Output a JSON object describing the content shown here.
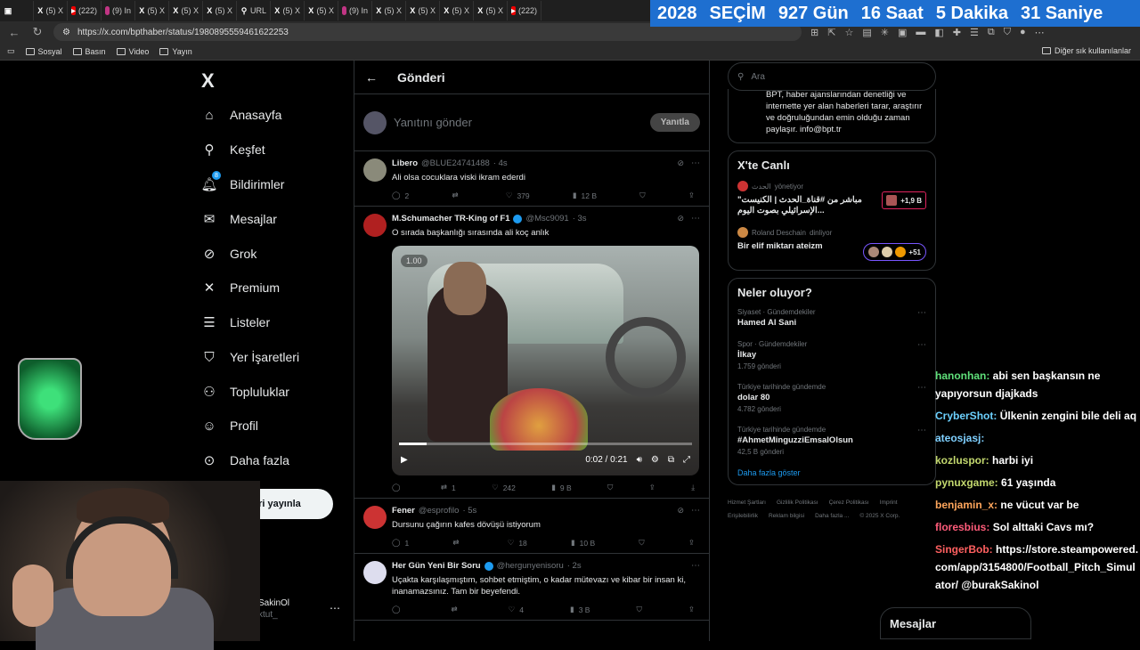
{
  "browser": {
    "tabs": [
      {
        "icon": "X",
        "label": "(5) X"
      },
      {
        "icon": "YT",
        "label": "(222)"
      },
      {
        "icon": "IG",
        "label": "(9) In"
      },
      {
        "icon": "X",
        "label": "(5) X"
      },
      {
        "icon": "X",
        "label": "(5) X"
      },
      {
        "icon": "X",
        "label": "(5) X"
      },
      {
        "icon": "URL",
        "label": "URL"
      },
      {
        "icon": "X",
        "label": "(5) X"
      },
      {
        "icon": "X",
        "label": "(5) X"
      },
      {
        "icon": "IG",
        "label": "(9) In"
      },
      {
        "icon": "X",
        "label": "(5) X"
      },
      {
        "icon": "X",
        "label": "(5) X"
      },
      {
        "icon": "X",
        "label": "(5) X"
      },
      {
        "icon": "X",
        "label": "(5) X"
      },
      {
        "icon": "YT",
        "label": "(222)"
      }
    ],
    "url": "https://x.com/bpthaber/status/1980895559461622253",
    "bookmarks": [
      "Sosyal",
      "Basın",
      "Video",
      "Yayın"
    ],
    "bookmarks_right": "Diğer sık kullanılanlar"
  },
  "countdown": {
    "year": "2028",
    "label": "SEÇİM",
    "days": "927 Gün",
    "hours": "16 Saat",
    "minutes": "5 Dakika",
    "seconds": "31 Saniye"
  },
  "nav": {
    "logo": "X",
    "items": [
      "Anasayfa",
      "Keşfet",
      "Bildirimler",
      "Mesajlar",
      "Grok",
      "Premium",
      "Listeler",
      "Yer İşaretleri",
      "Topluluklar",
      "Profil",
      "Daha fazla"
    ],
    "notif_count": "8",
    "post_button": "Gönderi yayınla",
    "account_name": "SakinOl",
    "account_handle": "ktut_"
  },
  "main": {
    "title": "Gönderi",
    "reply_placeholder": "Yanıtını gönder",
    "reply_button": "Yanıtla",
    "tweets": [
      {
        "name": "Libero",
        "handle": "@BLUE24741488",
        "time": "· 4s",
        "text": "Ali olsa cocuklara viski ikram ederdi",
        "replies": "2",
        "reposts": "",
        "likes": "379",
        "views": "12 B"
      },
      {
        "name": "M.Schumacher TR-King of F1",
        "handle": "@Msc9091",
        "time": "· 3s",
        "text": "O sırada başkanlığı sırasında ali koç anlık",
        "replies": "",
        "reposts": "1",
        "likes": "242",
        "views": "9 B",
        "video": {
          "speed": "1.00",
          "time": "0:02 / 0:21",
          "progress": 0.095
        }
      },
      {
        "name": "Fener",
        "handle": "@esprofilo",
        "time": "· 5s",
        "text": "Dursunu çağırın kafes dövüşü istiyorum",
        "replies": "1",
        "reposts": "",
        "likes": "18",
        "views": "10 B"
      },
      {
        "name": "Her Gün Yeni Bir Soru",
        "handle": "@hergunyenisoru",
        "time": "· 2s",
        "text": "Uçakta karşılaşmıştım, sohbet etmiştim, o kadar mütevazı ve kibar bir insan ki, inanamazsınız. Tam bir beyefendi.",
        "replies": "",
        "reposts": "",
        "likes": "4",
        "views": "3 B"
      }
    ]
  },
  "right": {
    "search_placeholder": "Ara",
    "about_text": "BPT, haber ajanslarından denetliği ve internette yer alan haberleri tarar, araştırır ve doğruluğundan emin olduğu zaman paylaşır. info@bpt.tr",
    "live_title": "X'te Canlı",
    "live": [
      {
        "host": "الحدث",
        "role": "yönetiyor",
        "title": "مباشر من #قناة_الحدث | الكنيست\" الإسرائيلي بصوت اليوم...",
        "badge": "+1,9 B"
      },
      {
        "host": "Roland Deschain",
        "role": "dinliyor",
        "title": "Bir elif miktarı ateizm",
        "badge": "+51"
      }
    ],
    "trends_title": "Neler oluyor?",
    "trends": [
      {
        "cat": "Siyaset · Gündemdekiler",
        "name": "Hamed Al Sani",
        "count": ""
      },
      {
        "cat": "Spor · Gündemdekiler",
        "name": "İlkay",
        "count": "1.759 gönderi"
      },
      {
        "cat": "Türkiye tarihinde gündemde",
        "name": "dolar 80",
        "count": "4.782 gönderi"
      },
      {
        "cat": "Türkiye tarihinde gündemde",
        "name": "#AhmetMinguzziEmsalOlsun",
        "count": "42,5 B gönderi"
      }
    ],
    "show_more": "Daha fazla göster",
    "footer": [
      "Hizmet Şartları",
      "Gizlilik Politikası",
      "Çerez Politikası",
      "Imprint",
      "Erişilebilirlik",
      "Reklam bilgisi",
      "Daha fazla ...",
      "© 2025 X Corp."
    ]
  },
  "chat": [
    {
      "user": "hanonhan:",
      "text": "abi sen başkansın ne yapıyorsun djajkads"
    },
    {
      "user": "CryberShot:",
      "text": "Ülkenin zengini bile deli aq"
    },
    {
      "user": "ateosjasj:",
      "text": ""
    },
    {
      "user": "kozluspor:",
      "text": "harbi iyi"
    },
    {
      "user": "pynuxgame:",
      "text": "61 yaşında"
    },
    {
      "user": "benjamin_x:",
      "text": "ne vücut var be"
    },
    {
      "user": "floresbius:",
      "text": "Sol alttaki Cavs mı?"
    },
    {
      "user": "SingerBob:",
      "text": "https://store.steampowered.com/app/3154800/Football_Pitch_Simulator/ @burakSakinol"
    }
  ],
  "message_drawer": "Mesajlar"
}
